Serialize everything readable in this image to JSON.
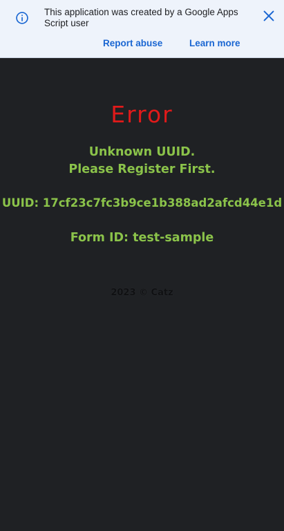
{
  "banner": {
    "message": "This application was created by a Google Apps Script user",
    "report_abuse_label": "Report abuse",
    "learn_more_label": "Learn more",
    "info_icon": "info-icon",
    "close_icon": "close-icon",
    "accent_color": "#1a66d2",
    "background_color": "#eef3fb"
  },
  "main": {
    "error_title": "Error",
    "message_line1": "Unknown UUID.",
    "message_line2": "Please Register First.",
    "uuid_text": "UUID: 17cf23c7fc3b9ce1b388ad2afcd44e1d",
    "form_id_text": "Form ID: test-sample",
    "footer_text": "2023 © Catz",
    "error_color": "#e01a1a",
    "text_color": "#8bc34a",
    "background_color": "#1f2124"
  }
}
